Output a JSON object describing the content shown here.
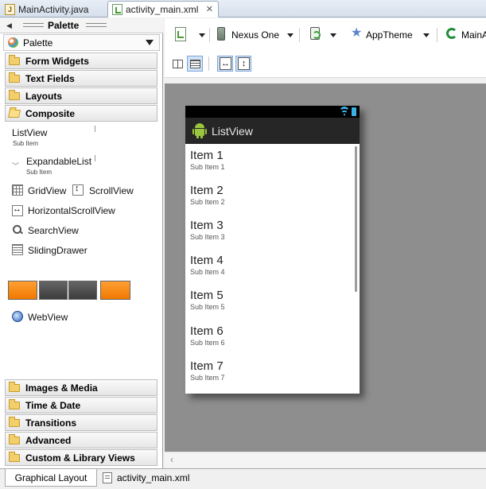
{
  "editor_tabs": [
    {
      "label": "MainActivity.java"
    },
    {
      "label": "activity_main.xml"
    }
  ],
  "palette": {
    "title": "Palette",
    "selector": "Palette",
    "categories_top": [
      {
        "label": "Form Widgets"
      },
      {
        "label": "Text Fields"
      },
      {
        "label": "Layouts"
      },
      {
        "label": "Composite"
      }
    ],
    "widgets": {
      "listview": {
        "label": "ListView",
        "sub": "Sub Item"
      },
      "expandable": {
        "label": "ExpandableList",
        "sub": "Sub Item"
      },
      "gridview": "GridView",
      "scrollview": "ScrollView",
      "hscrollview": "HorizontalScrollView",
      "searchview": "SearchView",
      "slidingdrawer": "SlidingDrawer",
      "webview": "WebView"
    },
    "categories_bottom": [
      {
        "label": "Images & Media"
      },
      {
        "label": "Time & Date"
      },
      {
        "label": "Transitions"
      },
      {
        "label": "Advanced"
      },
      {
        "label": "Custom & Library Views"
      }
    ]
  },
  "toolbar": {
    "device": "Nexus One",
    "theme": "AppTheme",
    "activity": "MainA"
  },
  "phone": {
    "title": "ListView",
    "items": [
      {
        "title": "Item 1",
        "sub": "Sub Item 1"
      },
      {
        "title": "Item 2",
        "sub": "Sub Item 2"
      },
      {
        "title": "Item 3",
        "sub": "Sub Item 3"
      },
      {
        "title": "Item 4",
        "sub": "Sub Item 4"
      },
      {
        "title": "Item 5",
        "sub": "Sub Item 5"
      },
      {
        "title": "Item 6",
        "sub": "Sub Item 6"
      },
      {
        "title": "Item 7",
        "sub": "Sub Item 7"
      }
    ]
  },
  "bottom_tabs": {
    "graphical": "Graphical Layout",
    "xml": "activity_main.xml"
  }
}
